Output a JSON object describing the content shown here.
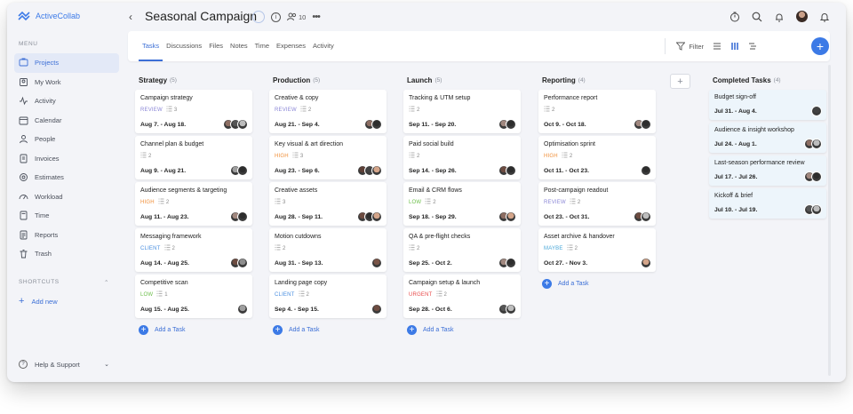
{
  "app": {
    "name": "ActiveCollab"
  },
  "sidebar": {
    "menu_heading": "MENU",
    "items": [
      {
        "label": "Projects",
        "icon": "projects-icon",
        "active": true
      },
      {
        "label": "My Work",
        "icon": "my-work-icon"
      },
      {
        "label": "Activity",
        "icon": "activity-icon"
      },
      {
        "label": "Calendar",
        "icon": "calendar-icon"
      },
      {
        "label": "People",
        "icon": "people-icon"
      },
      {
        "label": "Invoices",
        "icon": "invoices-icon"
      },
      {
        "label": "Estimates",
        "icon": "estimates-icon"
      },
      {
        "label": "Workload",
        "icon": "workload-icon"
      },
      {
        "label": "Time",
        "icon": "time-icon"
      },
      {
        "label": "Reports",
        "icon": "reports-icon"
      },
      {
        "label": "Trash",
        "icon": "trash-icon"
      }
    ],
    "shortcuts_heading": "SHORTCUTS",
    "add_new": "Add new",
    "help": "Help & Support"
  },
  "header": {
    "title": "Seasonal Campaign",
    "people_count": "10"
  },
  "tabs": [
    "Tasks",
    "Discussions",
    "Files",
    "Notes",
    "Time",
    "Expenses",
    "Activity"
  ],
  "active_tab": "Tasks",
  "toolbar": {
    "filter": "Filter"
  },
  "board": {
    "add_task_label": "Add a Task",
    "columns": [
      {
        "name": "Strategy",
        "count": "(5)",
        "cards": [
          {
            "title": "Campaign strategy",
            "label": "REVIEW",
            "subtasks": "3",
            "date": "Aug 7. - Aug 18.",
            "avatars": [
              "#8d6e63",
              "#555555",
              "#bdbdbd"
            ]
          },
          {
            "title": "Channel plan & budget",
            "label": "",
            "subtasks": "2",
            "date": "Aug 9. - Aug 21.",
            "avatars": [
              "#9e9e9e",
              "#2d2d2d"
            ]
          },
          {
            "title": "Audience segments & targeting",
            "label": "HIGH",
            "subtasks": "2",
            "date": "Aug 11. - Aug 23.",
            "avatars": [
              "#a1887f",
              "#2d2d2d"
            ]
          },
          {
            "title": "Messaging framework",
            "label": "CLIENT",
            "subtasks": "2",
            "date": "Aug 14. - Aug 25.",
            "avatars": [
              "#6d4c41",
              "#8d8d8d"
            ]
          },
          {
            "title": "Competitive scan",
            "label": "LOW",
            "subtasks": "1",
            "date": "Aug 15. - Aug 25.",
            "avatars": [
              "#9e9e9e"
            ]
          }
        ]
      },
      {
        "name": "Production",
        "count": "(5)",
        "cards": [
          {
            "title": "Creative & copy",
            "label": "REVIEW",
            "subtasks": "2",
            "date": "Aug 21. - Sep 4.",
            "avatars": [
              "#8d6e63",
              "#2d2d2d"
            ]
          },
          {
            "title": "Key visual & art direction",
            "label": "HIGH",
            "subtasks": "3",
            "date": "Aug 23. - Sep 6.",
            "avatars": [
              "#5d4037",
              "#424242",
              "#d4a58a"
            ]
          },
          {
            "title": "Creative assets",
            "label": "",
            "subtasks": "3",
            "date": "Aug 28. - Sep 11.",
            "avatars": [
              "#6d4c41",
              "#2d2d2d",
              "#d4a58a"
            ]
          },
          {
            "title": "Motion cutdowns",
            "label": "",
            "subtasks": "2",
            "date": "Aug 31. - Sep 13.",
            "avatars": [
              "#795548"
            ]
          },
          {
            "title": "Landing page copy",
            "label": "CLIENT",
            "subtasks": "2",
            "date": "Sep 4. - Sep 15.",
            "avatars": [
              "#6d4c41"
            ]
          }
        ]
      },
      {
        "name": "Launch",
        "count": "(5)",
        "cards": [
          {
            "title": "Tracking & UTM setup",
            "label": "",
            "subtasks": "2",
            "date": "Sep 11. - Sep 20.",
            "avatars": [
              "#a1887f",
              "#2d2d2d"
            ]
          },
          {
            "title": "Paid social build",
            "label": "",
            "subtasks": "2",
            "date": "Sep 14. - Sep 26.",
            "avatars": [
              "#6d4c41",
              "#2d2d2d"
            ]
          },
          {
            "title": "Email & CRM flows",
            "label": "LOW",
            "subtasks": "2",
            "date": "Sep 18. - Sep 29.",
            "avatars": [
              "#8d6e63",
              "#d4a58a"
            ]
          },
          {
            "title": "QA & pre-flight checks",
            "label": "",
            "subtasks": "2",
            "date": "Sep 25. - Oct 2.",
            "avatars": [
              "#a1887f",
              "#2d2d2d"
            ]
          },
          {
            "title": "Campaign setup & launch",
            "label": "URGENT",
            "subtasks": "2",
            "date": "Sep 28. - Oct 6.",
            "avatars": [
              "#555555",
              "#bdbdbd"
            ]
          }
        ]
      },
      {
        "name": "Reporting",
        "count": "(4)",
        "cards": [
          {
            "title": "Performance report",
            "label": "",
            "subtasks": "2",
            "date": "Oct 9. - Oct 18.",
            "avatars": [
              "#a1887f",
              "#2d2d2d"
            ]
          },
          {
            "title": "Optimisation sprint",
            "label": "HIGH",
            "subtasks": "2",
            "date": "Oct 11. - Oct 23.",
            "avatars": [
              "#2d2d2d"
            ]
          },
          {
            "title": "Post-campaign readout",
            "label": "REVIEW",
            "subtasks": "2",
            "date": "Oct 23. - Oct 31.",
            "avatars": [
              "#6d4c41",
              "#bdbdbd"
            ]
          },
          {
            "title": "Asset archive & handover",
            "label": "MAYBE",
            "subtasks": "2",
            "date": "Oct 27. - Nov 3.",
            "avatars": [
              "#d4a58a"
            ]
          }
        ]
      }
    ],
    "completed": {
      "name": "Completed Tasks",
      "count": "(4)",
      "cards": [
        {
          "title": "Budget sign-off",
          "date": "Jul 31. - Aug 4.",
          "avatars": [
            "#424242"
          ]
        },
        {
          "title": "Audience & insight workshop",
          "date": "Jul 24. - Aug 1.",
          "avatars": [
            "#8d6e63",
            "#bdbdbd"
          ]
        },
        {
          "title": "Last-season performance review",
          "date": "Jul 17. - Jul 26.",
          "avatars": [
            "#a1887f",
            "#2d2d2d"
          ]
        },
        {
          "title": "Kickoff & brief",
          "date": "Jul 10. - Jul 19.",
          "avatars": [
            "#555555",
            "#bdbdbd"
          ]
        }
      ]
    }
  },
  "label_colors": {
    "REVIEW": "#8a86d6",
    "HIGH": "#f0903a",
    "CLIENT": "#4a8fe0",
    "LOW": "#6cbf4a",
    "URGENT": "#e84a4a",
    "MAYBE": "#4aa8d8"
  },
  "accent": "#3c7ae6"
}
